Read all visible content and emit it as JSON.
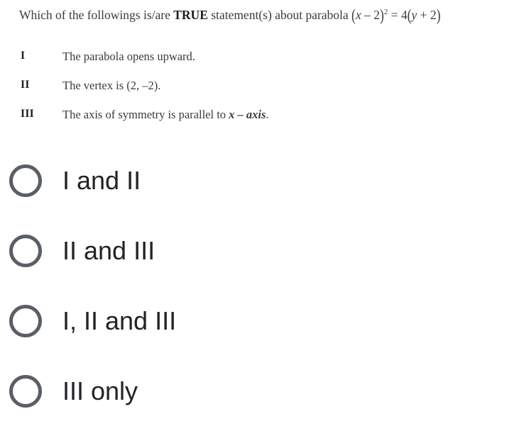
{
  "question": {
    "lead": "Which of the followings is/are ",
    "emphasis": "TRUE",
    "mid": " statement(s) about parabola ",
    "equation": "(x − 2)² = 4(y + 2)",
    "equation_parts": {
      "open_paren": "(",
      "x_var": "x",
      "minus": " – ",
      "two": "2",
      "close_paren": ")",
      "exponent": "2",
      "equals": " = ",
      "four": "4",
      "open_paren2": "(",
      "y_var": "y",
      "plus": " + ",
      "two2": "2",
      "close_paren2": ")"
    }
  },
  "statements": [
    {
      "numeral": "I",
      "text": "The parabola opens upward.",
      "text_plain": "The parabola opens upward."
    },
    {
      "numeral": "II",
      "text_before": "The vertex is ",
      "coordinates": "(2, –2)",
      "text_after": ".",
      "text_plain": "The vertex is (2, –2)."
    },
    {
      "numeral": "III",
      "text_before": "The axis of symmetry is parallel to ",
      "axis_term": "x – axis",
      "text_after": ".",
      "text_plain": "The axis of symmetry is parallel to x – axis."
    }
  ],
  "options": [
    {
      "id": "option-a",
      "label": "I and II",
      "selected": false
    },
    {
      "id": "option-b",
      "label": "II and III",
      "selected": false
    },
    {
      "id": "option-c",
      "label": "I, II and III",
      "selected": false
    },
    {
      "id": "option-d",
      "label": "III only",
      "selected": false
    }
  ],
  "colors": {
    "background": "#ffffff",
    "question_text": "#3b3b40",
    "emphasis_text": "#1c1c20",
    "option_text": "#232327",
    "radio_stroke": "#5a5f66"
  }
}
